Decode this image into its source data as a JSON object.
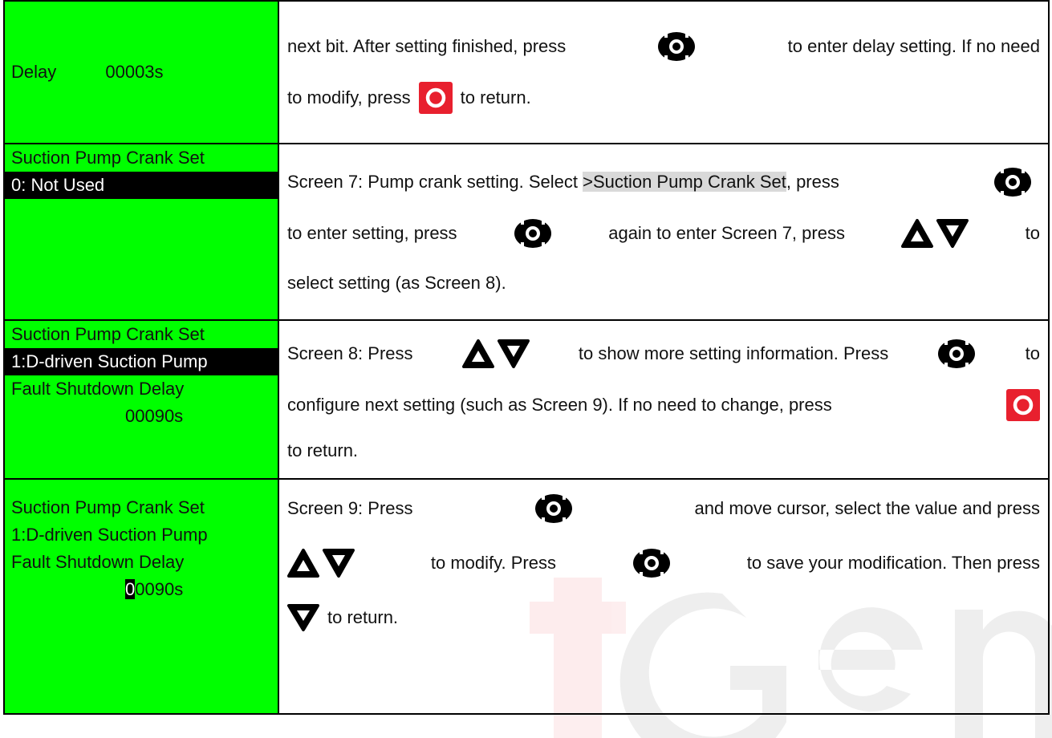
{
  "rows": [
    {
      "lcd": [
        "Delay          00003s"
      ],
      "desc": {
        "l1a": "next bit. After setting finished, press",
        "l1b": "to enter delay setting. If no need",
        "l2a": "to modify, press",
        "l2b": "to return."
      }
    },
    {
      "lcd": [
        "Suction Pump Crank Set",
        "0: Not Used"
      ],
      "desc": {
        "l1a": "Screen 7: Pump crank setting. Select",
        "l1hl": ">Suction Pump Crank Set",
        "l1b": ", press",
        "l2a": "to enter setting, press",
        "l2b": "again to enter Screen 7, press",
        "l2c": "to",
        "l3a": "select setting (as Screen 8)."
      }
    },
    {
      "lcd": [
        "Suction Pump Crank Set",
        "1:D-driven Suction Pump",
        "Fault Shutdown Delay",
        "00090s"
      ],
      "desc": {
        "l1a": "Screen 8: Press",
        "l1b": "to show more setting information. Press",
        "l1c": "to",
        "l2a": "configure next setting (such as Screen 9). If no need to change, press",
        "l3a": "to return."
      }
    },
    {
      "lcd": [
        "Suction Pump Crank Set",
        "1:D-driven Suction Pump",
        "Fault Shutdown Delay"
      ],
      "lcd_cursor": "0",
      "lcd_rest": "0090s",
      "desc": {
        "l1a": "Screen 9: Press",
        "l1b": "and move cursor, select the value and press",
        "l2a": "to modify. Press",
        "l2b": "to save your modification. Then press",
        "l3a": "to return."
      }
    }
  ],
  "icons": {
    "confirm": "gear-confirm-icon",
    "return": "return-icon",
    "up": "up-arrow-icon",
    "down": "down-arrow-icon"
  },
  "colors": {
    "lcd_bg": "#00ff00",
    "return_red": "#e8202e",
    "watermark": "#e8202e"
  }
}
